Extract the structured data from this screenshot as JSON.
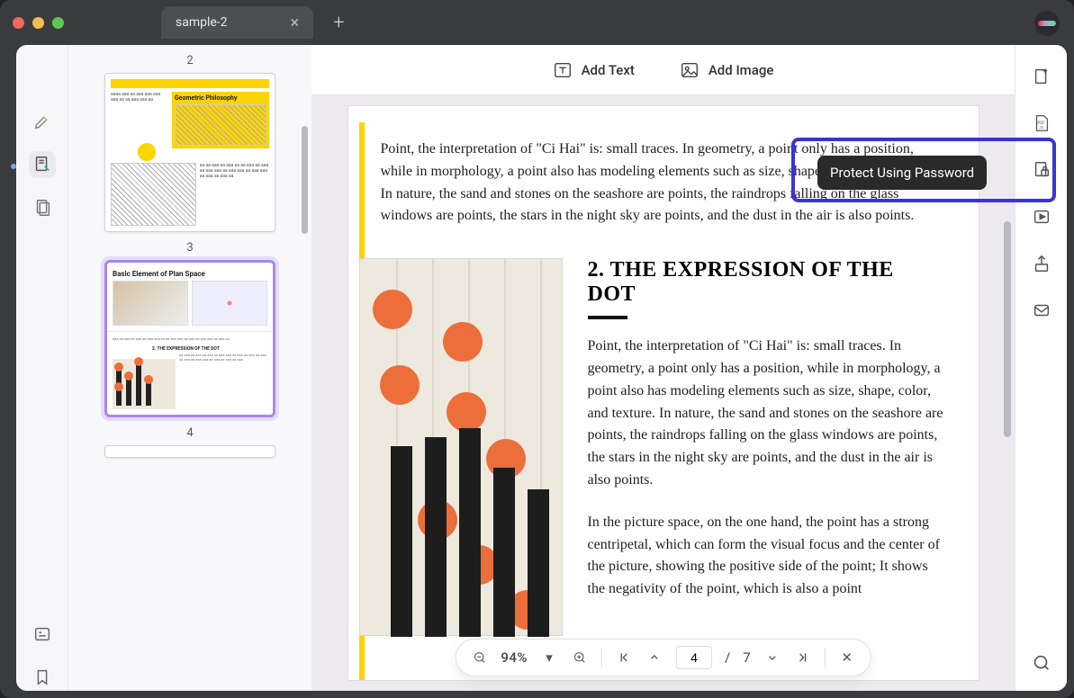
{
  "tab": {
    "title": "sample-2"
  },
  "toolbar": {
    "add_text": "Add Text",
    "add_image": "Add Image"
  },
  "tooltip": {
    "protect": "Protect Using Password"
  },
  "document": {
    "para1": "Point, the interpretation of \"Ci Hai\" is: small traces. In geometry, a point only has a position, while in morphology, a point also has modeling elements such as size, shape, color, and texture. In nature, the sand and stones on the seashore are points, the raindrops falling on the glass windows are points, the stars in the night sky are points, and the dust in the air is also points.",
    "heading": "2. THE EXPRESSION OF THE DOT",
    "para2": "Point, the interpretation of \"Ci Hai\" is: small traces. In geometry, a point only has a position, while in morphology, a point also has modeling elements such as size, shape, color, and texture. In nature, the sand and stones on the seashore are points, the raindrops falling on the glass windows are points, the stars in the night sky are points, and the dust in the air is also points.",
    "para3": "In the picture space, on the one hand, the point has a strong centripetal, which can form the visual focus and the center of the picture, showing the positive side of the point; It shows the negativity of the point, which is also a point"
  },
  "thumbs": {
    "p2": {
      "num": "2",
      "title": "Geometric Philosophy"
    },
    "p3": {
      "num": "3",
      "title": "Basic Element of Plan Space",
      "caption": "2. THE EXPRESSION OF THE DOT"
    },
    "p4": {
      "num": "4"
    }
  },
  "pager": {
    "zoom": "94%",
    "current": "4",
    "sep": "/",
    "total": "7"
  }
}
